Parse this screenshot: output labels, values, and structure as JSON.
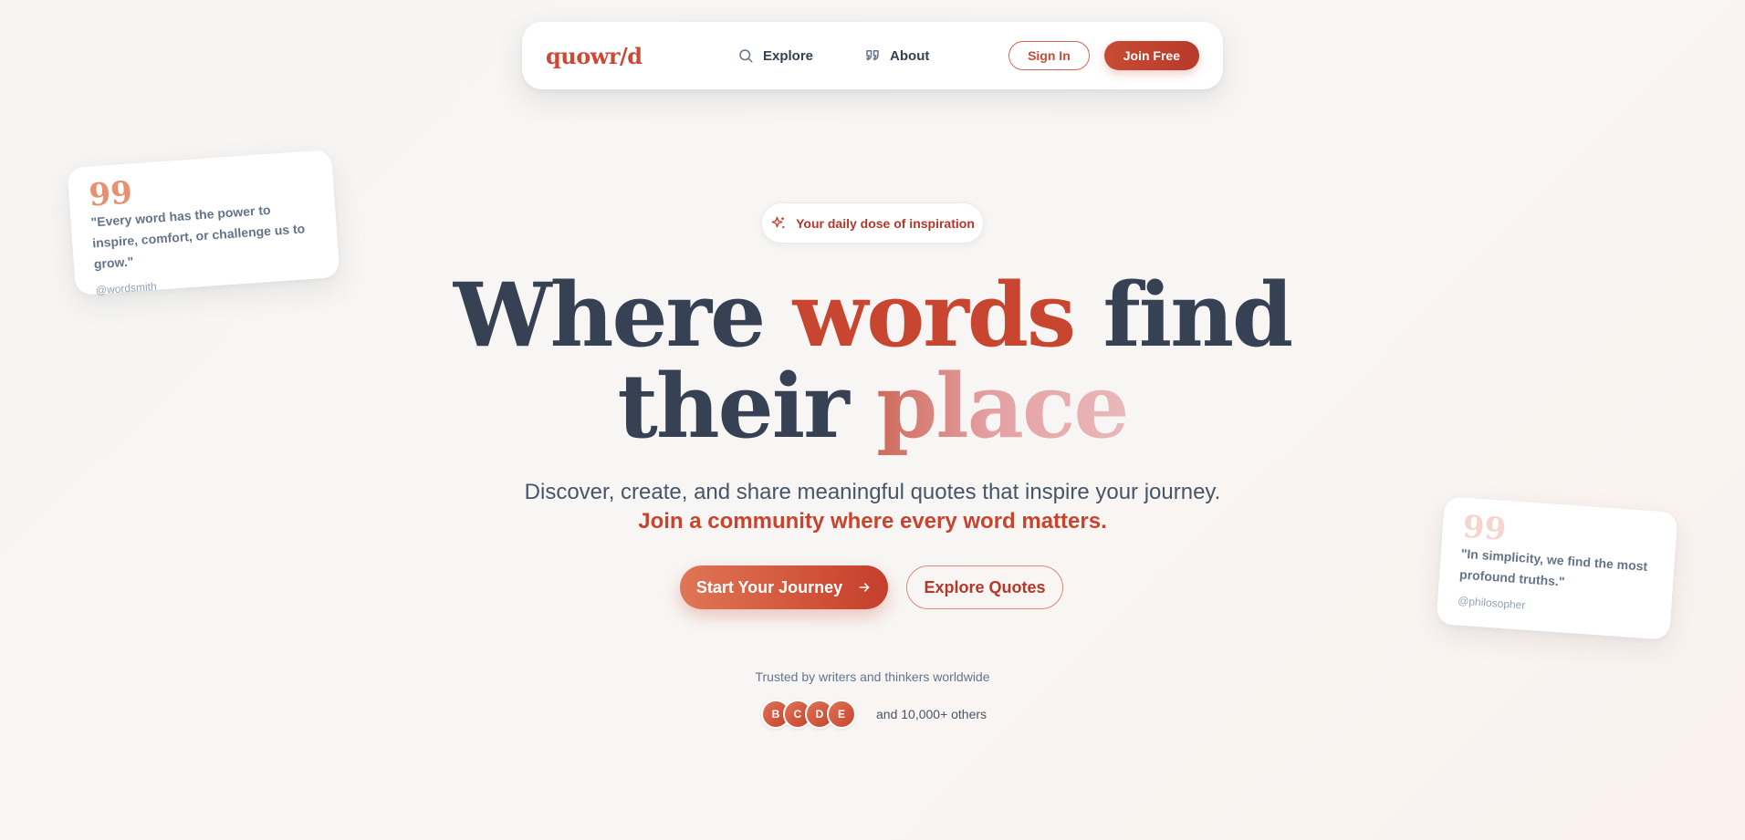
{
  "nav": {
    "logo": "quowr/d",
    "links": [
      {
        "label": "Explore",
        "icon": "search-icon"
      },
      {
        "label": "About",
        "icon": "quote-icon"
      }
    ],
    "sign_in": "Sign In",
    "join_free": "Join Free"
  },
  "cards": {
    "left": {
      "quote_mark": "99",
      "text": "\"Every word has the power to inspire, comfort, or challenge us to grow.\"",
      "author": "@wordsmith"
    },
    "right": {
      "quote_mark": "99",
      "text": "\"In simplicity, we find the most profound truths.\"",
      "author": "@philosopher"
    }
  },
  "hero": {
    "badge": "Your daily dose of inspiration",
    "headline": {
      "part1": "Where ",
      "accent1": "words",
      "part2": " find",
      "part3": "their ",
      "accent2": "place"
    },
    "subtitle": "Discover, create, and share meaningful quotes that inspire your journey.",
    "subtitle_accent": "Join a community where every word matters.",
    "cta_primary": "Start Your Journey",
    "cta_secondary": "Explore Quotes",
    "trusted": "Trusted by writers and thinkers worldwide",
    "avatars": [
      "B",
      "C",
      "D",
      "E"
    ],
    "others": "and 10,000+ others"
  },
  "colors": {
    "brand": "#cc4a35",
    "heading": "#364154",
    "background": "#f7f6f4"
  }
}
